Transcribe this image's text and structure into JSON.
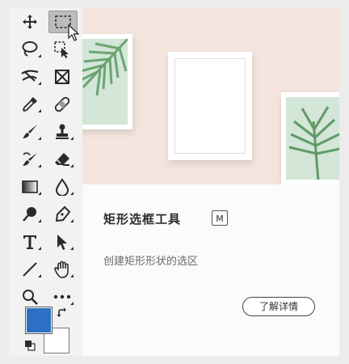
{
  "toolbar": {
    "tools": [
      {
        "name": "move-tool",
        "icon": "move-icon",
        "selected": false
      },
      {
        "name": "rectangular-marquee-tool",
        "icon": "rectangular-marquee-icon",
        "selected": true
      },
      {
        "name": "lasso-tool",
        "icon": "lasso-icon",
        "selected": false
      },
      {
        "name": "object-selection-tool",
        "icon": "object-selection-icon",
        "selected": false
      },
      {
        "name": "crop-tool",
        "icon": "crop-icon",
        "selected": false
      },
      {
        "name": "frame-tool",
        "icon": "frame-icon",
        "selected": false
      },
      {
        "name": "eyedropper-tool",
        "icon": "eyedropper-icon",
        "selected": false
      },
      {
        "name": "healing-brush-tool",
        "icon": "bandage-icon",
        "selected": false
      },
      {
        "name": "brush-tool",
        "icon": "brush-icon",
        "selected": false
      },
      {
        "name": "clone-stamp-tool",
        "icon": "stamp-icon",
        "selected": false
      },
      {
        "name": "history-brush-tool",
        "icon": "history-brush-icon",
        "selected": false
      },
      {
        "name": "eraser-tool",
        "icon": "eraser-icon",
        "selected": false
      },
      {
        "name": "gradient-tool",
        "icon": "gradient-icon",
        "selected": false
      },
      {
        "name": "blur-tool",
        "icon": "drop-icon",
        "selected": false
      },
      {
        "name": "dodge-tool",
        "icon": "dodge-icon",
        "selected": false
      },
      {
        "name": "pen-tool",
        "icon": "pen-icon",
        "selected": false
      },
      {
        "name": "type-tool",
        "icon": "type-icon",
        "selected": false
      },
      {
        "name": "path-selection-tool",
        "icon": "arrow-icon",
        "selected": false
      },
      {
        "name": "line-tool",
        "icon": "line-icon",
        "selected": false
      },
      {
        "name": "hand-tool",
        "icon": "hand-icon",
        "selected": false
      },
      {
        "name": "zoom-tool",
        "icon": "magnifier-icon",
        "selected": false
      },
      {
        "name": "more-tools",
        "icon": "ellipsis-icon",
        "selected": false
      }
    ],
    "foreground_color": "#2c6fc4",
    "background_color": "#ffffff"
  },
  "tooltip": {
    "tool_name": "矩形选框工具",
    "shortcut": "M",
    "description": "创建矩形形状的选区",
    "learn_more_label": "了解详情"
  }
}
